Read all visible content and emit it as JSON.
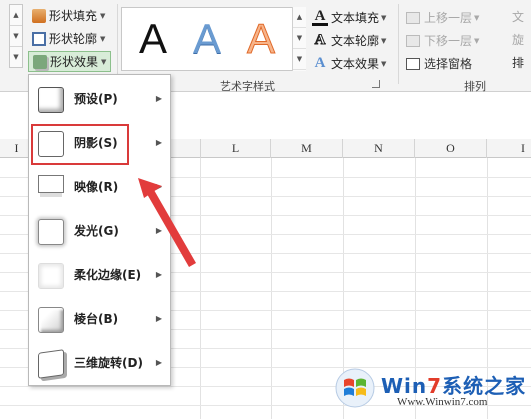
{
  "ribbon": {
    "shape_fill": "形状填充",
    "shape_outline": "形状轮廓",
    "shape_effect": "形状效果",
    "wordart_glyph": "A",
    "text_fill": "文本填充",
    "text_outline": "文本轮廓",
    "text_effect": "文本效果",
    "text_glyph": "A",
    "bring_forward": "上移一层",
    "send_backward": "下移一层",
    "selection_pane": "选择窗格",
    "right_clip_top": "文",
    "right_clip_mid": "旋",
    "right_clip_bot": "排",
    "group_wordart": "艺术字样式",
    "group_arrange": "排列"
  },
  "columns": [
    {
      "label": "I"
    },
    {
      "label": "L"
    },
    {
      "label": "M"
    },
    {
      "label": "N"
    },
    {
      "label": "O"
    },
    {
      "label": "I"
    }
  ],
  "menu": {
    "items": [
      {
        "label": "预设(P)"
      },
      {
        "label": "阴影(S)"
      },
      {
        "label": "映像(R)"
      },
      {
        "label": "发光(G)"
      },
      {
        "label": "柔化边缘(E)"
      },
      {
        "label": "棱台(B)"
      },
      {
        "label": "三维旋转(D)"
      }
    ],
    "highlighted_index": 1,
    "highlight_color": "#d93a3a"
  },
  "watermark": {
    "title_part1": "Win",
    "title_seven": "7",
    "title_part2": "系统之家",
    "url": "Www.Winwin7.com"
  },
  "icons": {
    "submenu": "chevron-right-icon",
    "dropdown": "chevron-down-icon",
    "windows_logo": "windows-logo-icon"
  }
}
